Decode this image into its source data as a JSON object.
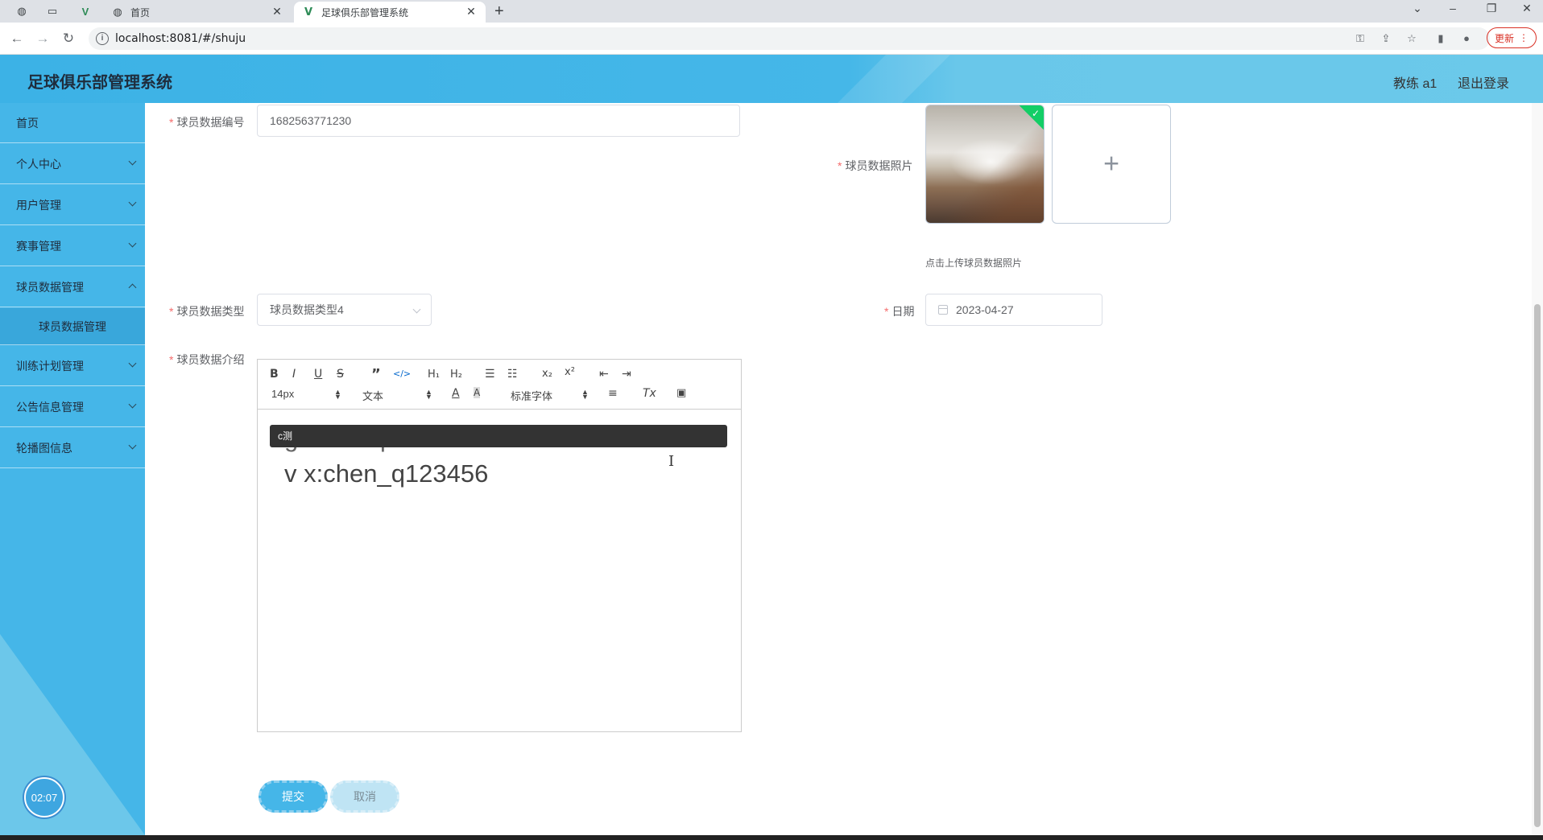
{
  "browser": {
    "tabs": [
      {
        "title": "首页",
        "active": false
      },
      {
        "title": "足球俱乐部管理系统",
        "active": true
      }
    ],
    "url": "localhost:8081/#/shuju",
    "update_label": "更新"
  },
  "header": {
    "title": "足球俱乐部管理系统",
    "user": "教练 a1",
    "logout": "退出登录"
  },
  "sidebar": {
    "items": [
      {
        "label": "首页"
      },
      {
        "label": "个人中心"
      },
      {
        "label": "用户管理"
      },
      {
        "label": "赛事管理"
      },
      {
        "label": "球员数据管理"
      },
      {
        "label": "训练计划管理"
      },
      {
        "label": "公告信息管理"
      },
      {
        "label": "轮播图信息"
      }
    ],
    "subitem": "球员数据管理",
    "timer": "02:07"
  },
  "form": {
    "id_label": "球员数据编号",
    "id_value": "1682563771230",
    "photo_label": "球员数据照片",
    "photo_hint": "点击上传球员数据照片",
    "type_label": "球员数据类型",
    "type_value": "球员数据类型4",
    "date_label": "日期",
    "date_value": "2023-04-27",
    "intro_label": "球员数据介绍",
    "submit": "提交",
    "cancel": "取消"
  },
  "editor": {
    "font_size": "14px",
    "header_select": "文本",
    "font_family": "标准字体",
    "tooltip": "c测",
    "lines": [
      "git:chenqi199",
      "v x:chen_q123456"
    ]
  },
  "colors": {
    "primary": "#45b6e8",
    "required": "#f56c6c",
    "success": "#13ce66"
  }
}
